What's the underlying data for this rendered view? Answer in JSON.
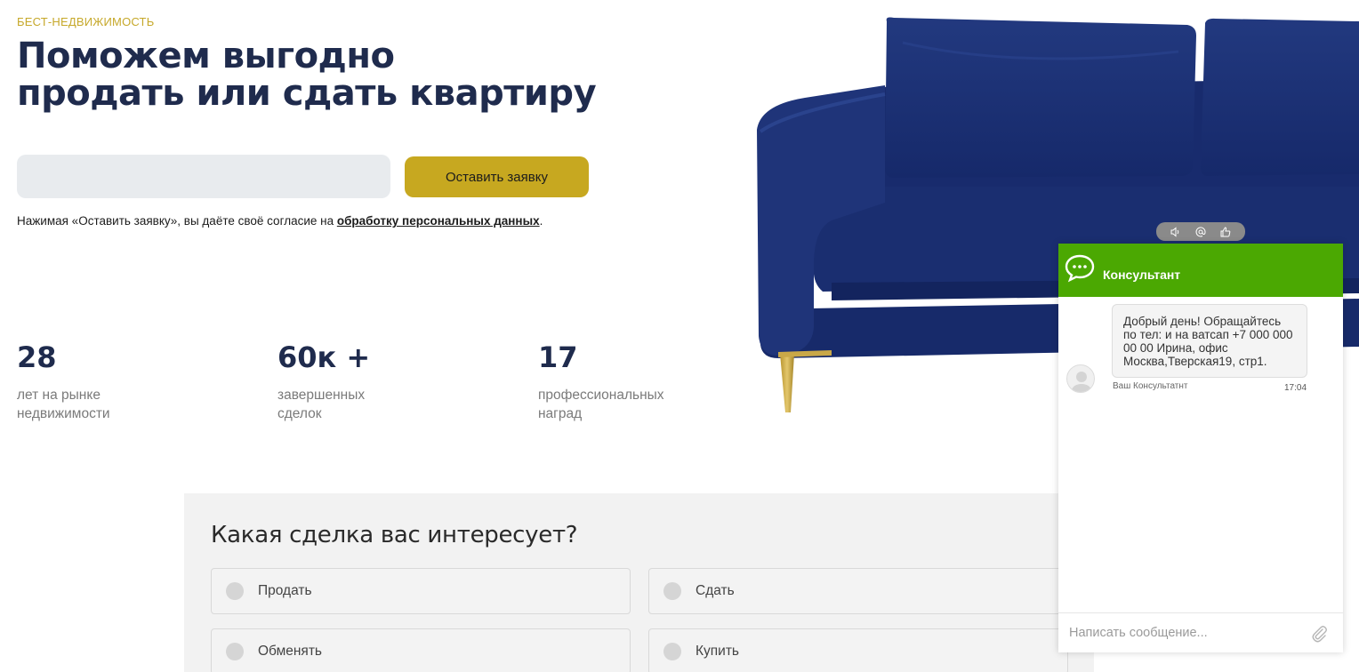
{
  "hero": {
    "brand": "БЕСТ-НЕДВИЖИМОСТЬ",
    "headline_line1": "Поможем выгодно",
    "headline_line2": "продать или сдать квартиру",
    "submit_label": "Оставить заявку",
    "consent_prefix": "Нажимая «Оставить заявку», вы даёте своё согласие на ",
    "consent_link": "обработку персональных данных",
    "consent_suffix": "."
  },
  "stats": [
    {
      "value": "28",
      "label_line1": "лет на рынке",
      "label_line2": "недвижимости"
    },
    {
      "value": "60к +",
      "label_line1": "завершенных",
      "label_line2": "сделок"
    },
    {
      "value": "17",
      "label_line1": "профессиональных",
      "label_line2": "наград"
    }
  ],
  "deal": {
    "title": "Какая сделка вас интересует?",
    "options": [
      "Продать",
      "Сдать",
      "Обменять",
      "Купить"
    ]
  },
  "chat": {
    "title": "Консультант",
    "message": "Добрый день! Обращайтесь по тел: и на ватсап +7 000 000 00 00 Ирина, офис Москва,Тверская19, стр1.",
    "author": "Ваш Консультатнт",
    "time": "17:04",
    "input_placeholder": "Написать сообщение...",
    "toolbar_icons": [
      "sound-icon",
      "email-icon",
      "thumbs-up-icon"
    ],
    "header_color": "#4ba802"
  },
  "colors": {
    "accent": "#c7a820",
    "headline": "#1f2b4d",
    "sofa": "#1d3376"
  }
}
